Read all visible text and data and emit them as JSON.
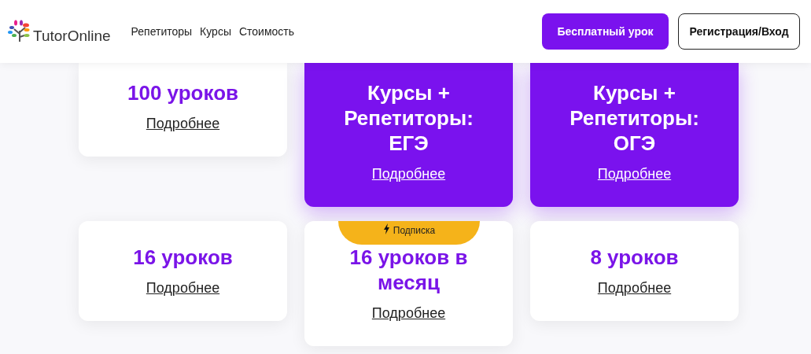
{
  "header": {
    "logo": "TutorOnline",
    "nav": [
      "Репетиторы",
      "Курсы",
      "Стоимость"
    ],
    "buttons": [
      {
        "label": "Бесплатный урок",
        "kind": "primary"
      },
      {
        "label": "Регистрация/Вход",
        "kind": "outline"
      }
    ]
  },
  "rows": [
    {
      "cards": [
        {
          "title": "100 уроков",
          "link": "Подробнее",
          "kind": "white"
        },
        {
          "title": "Курсы + Репетиторы: ЕГЭ",
          "link": "Подробнее",
          "kind": "purple"
        },
        {
          "title": "Курсы + Репетиторы: ОГЭ",
          "link": "Подробнее",
          "kind": "purple"
        }
      ]
    },
    {
      "cards": [
        {
          "title": "16 уроков",
          "link": "Подробнее",
          "kind": "white"
        },
        {
          "title": "16 уроков в месяц",
          "link": "Подробнее",
          "kind": "white",
          "badge": "Подписка"
        },
        {
          "title": "8 уроков",
          "link": "Подробнее",
          "kind": "white"
        }
      ]
    }
  ]
}
